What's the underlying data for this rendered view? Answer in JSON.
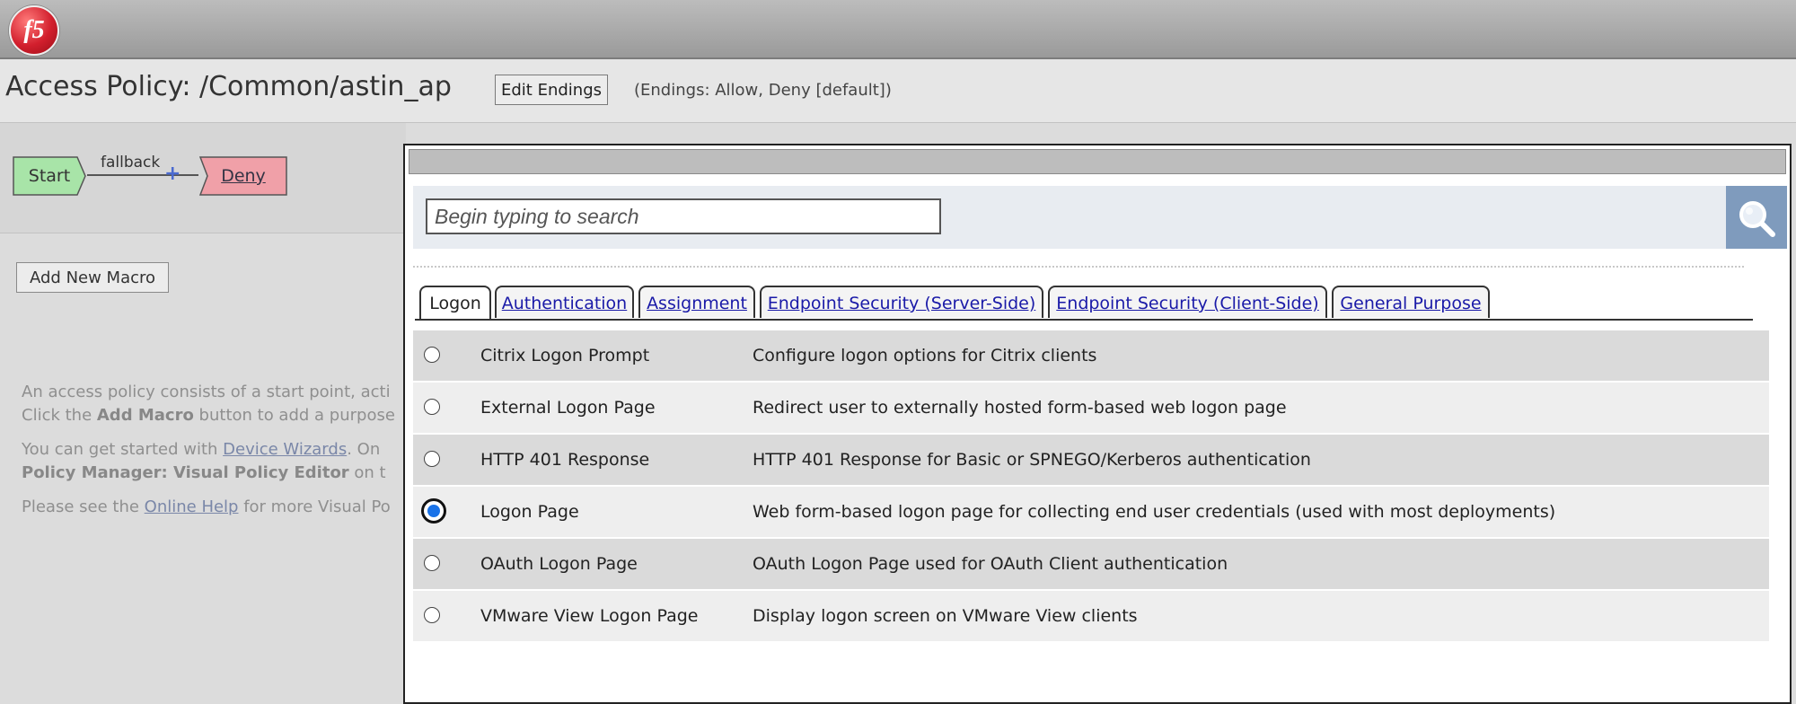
{
  "app": {
    "logo_text": "f5"
  },
  "header": {
    "title": "Access Policy: /Common/astin_ap",
    "edit_endings_label": "Edit Endings",
    "endings_text": "(Endings: Allow, Deny [default])"
  },
  "flow": {
    "start_label": "Start",
    "edge_label": "fallback",
    "plus": "+",
    "deny_label": "Deny"
  },
  "sidebar": {
    "add_macro_label": "Add New Macro",
    "help": {
      "line1": "An access policy consists of a start point, acti",
      "line2_pre": "Click the ",
      "line2_bold": "Add Macro",
      "line2_post": " button to add a purpose",
      "line3_pre": "You can get started with ",
      "line3_link": "Device Wizards",
      "line3_post": ". On",
      "line4_bold": "Policy Manager: Visual Policy Editor",
      "line4_post": " on t",
      "line5_pre": "Please see the ",
      "line5_link": "Online Help",
      "line5_post": " for more Visual Po"
    }
  },
  "dialog": {
    "search": {
      "placeholder": "Begin typing to search",
      "value": ""
    },
    "tabs": [
      {
        "label": "Logon",
        "active": true
      },
      {
        "label": "Authentication",
        "active": false
      },
      {
        "label": "Assignment",
        "active": false
      },
      {
        "label": "Endpoint Security (Server-Side)",
        "active": false
      },
      {
        "label": "Endpoint Security (Client-Side)",
        "active": false
      },
      {
        "label": "General Purpose",
        "active": false
      }
    ],
    "items": [
      {
        "name": "Citrix Logon Prompt",
        "description": "Configure logon options for Citrix clients",
        "selected": false
      },
      {
        "name": "External Logon Page",
        "description": "Redirect user to externally hosted form-based web logon page",
        "selected": false
      },
      {
        "name": "HTTP 401 Response",
        "description": "HTTP 401 Response for Basic or SPNEGO/Kerberos authentication",
        "selected": false
      },
      {
        "name": "Logon Page",
        "description": "Web form-based logon page for collecting end user credentials (used with most deployments)",
        "selected": true
      },
      {
        "name": "OAuth Logon Page",
        "description": "OAuth Logon Page used for OAuth Client authentication",
        "selected": false
      },
      {
        "name": "VMware View Logon Page",
        "description": "Display logon screen on VMware View clients",
        "selected": false
      }
    ]
  },
  "colors": {
    "accent": "#1a73e8",
    "start_node": "#a8e4a8",
    "deny_node": "#f0a0a8",
    "search_button": "#7f9bbd"
  },
  "icons": {
    "search": "magnifier-icon"
  }
}
